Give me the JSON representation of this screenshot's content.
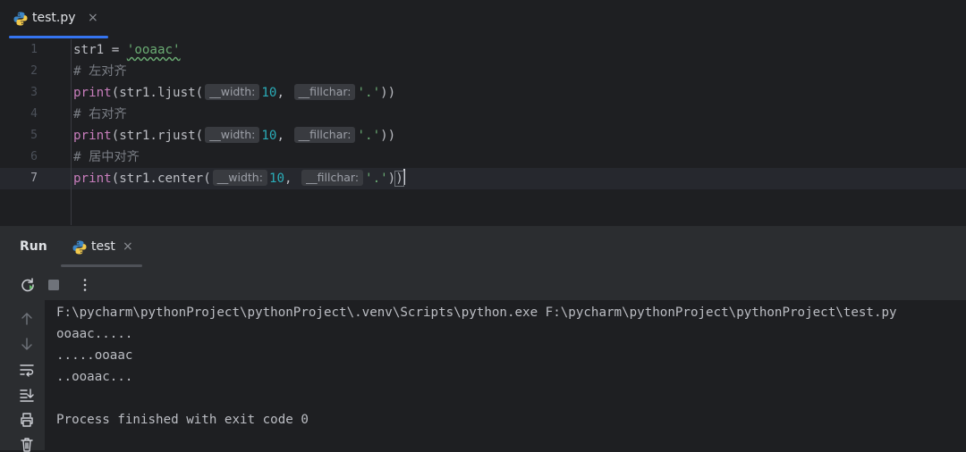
{
  "editor": {
    "tab": {
      "label": "test.py",
      "close": "×",
      "icon": "python-file-icon"
    },
    "line_numbers": [
      "1",
      "2",
      "3",
      "4",
      "5",
      "6",
      "7"
    ],
    "active_line": "7",
    "lines": [
      {
        "a": "str1 = ",
        "s": "'ooaac'"
      },
      {
        "comment": "# 左对齐"
      },
      {
        "fn": "print",
        "pre": "(str1.ljust(",
        "hint_width": "__width:",
        "n": "10",
        "comma": ",",
        "hint_fill": "__fillchar:",
        "s": "'.'",
        "post": "))"
      },
      {
        "comment": "# 右对齐"
      },
      {
        "fn": "print",
        "pre": "(str1.rjust(",
        "hint_width": "__width:",
        "n": "10",
        "comma": ",",
        "hint_fill": "__fillchar:",
        "s": "'.'",
        "post": "))"
      },
      {
        "comment": "# 居中对齐"
      },
      {
        "fn": "print",
        "pre": "(str1.center(",
        "hint_width": "__width:",
        "n": "10",
        "comma": ",",
        "hint_fill": "__fillchar:",
        "s": "'.'",
        "post1": ")",
        "post2": ")"
      }
    ]
  },
  "run": {
    "title": "Run",
    "tab": {
      "label": "test",
      "close": "×",
      "icon": "python-file-icon"
    },
    "toolbar": {
      "rerun": "rerun-icon",
      "stop": "stop-icon",
      "more": "more-options-icon"
    },
    "sidebar_icons": [
      "arrow-up-icon",
      "arrow-down-icon",
      "soft-wrap-icon",
      "scroll-to-end-icon",
      "print-icon",
      "trash-icon"
    ],
    "console_lines": [
      "F:\\pycharm\\pythonProject\\pythonProject\\.venv\\Scripts\\python.exe F:\\pycharm\\pythonProject\\pythonProject\\test.py",
      "ooaac.....",
      ".....ooaac",
      "..ooaac...",
      "",
      "Process finished with exit code 0"
    ]
  },
  "colors": {
    "background": "#1e1f22",
    "panel": "#2b2d30",
    "accent": "#3574f0",
    "keyword": "#c77dbb",
    "string": "#6aab73",
    "number": "#2aacb8",
    "comment": "#7a7e85"
  }
}
